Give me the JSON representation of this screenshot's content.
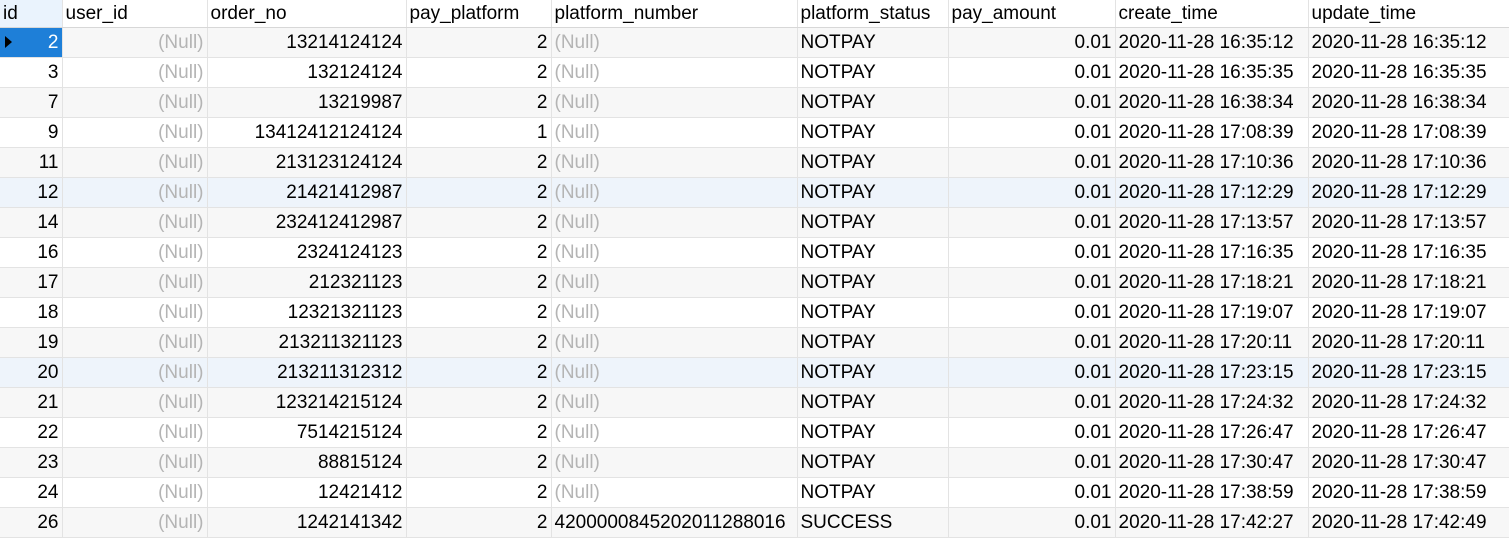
{
  "columns": [
    "id",
    "user_id",
    "order_no",
    "pay_platform",
    "platform_number",
    "platform_status",
    "pay_amount",
    "create_time",
    "update_time"
  ],
  "rows": [
    {
      "id": "2",
      "user_id": "(Null)",
      "order_no": "13214124124",
      "pay_platform": "2",
      "platform_number": "(Null)",
      "platform_status": "NOTPAY",
      "pay_amount": "0.01",
      "create_time": "2020-11-28 16:35:12",
      "update_time": "2020-11-28 16:35:12"
    },
    {
      "id": "3",
      "user_id": "(Null)",
      "order_no": "132124124",
      "pay_platform": "2",
      "platform_number": "(Null)",
      "platform_status": "NOTPAY",
      "pay_amount": "0.01",
      "create_time": "2020-11-28 16:35:35",
      "update_time": "2020-11-28 16:35:35"
    },
    {
      "id": "7",
      "user_id": "(Null)",
      "order_no": "13219987",
      "pay_platform": "2",
      "platform_number": "(Null)",
      "platform_status": "NOTPAY",
      "pay_amount": "0.01",
      "create_time": "2020-11-28 16:38:34",
      "update_time": "2020-11-28 16:38:34"
    },
    {
      "id": "9",
      "user_id": "(Null)",
      "order_no": "13412412124124",
      "pay_platform": "1",
      "platform_number": "(Null)",
      "platform_status": "NOTPAY",
      "pay_amount": "0.01",
      "create_time": "2020-11-28 17:08:39",
      "update_time": "2020-11-28 17:08:39"
    },
    {
      "id": "11",
      "user_id": "(Null)",
      "order_no": "213123124124",
      "pay_platform": "2",
      "platform_number": "(Null)",
      "platform_status": "NOTPAY",
      "pay_amount": "0.01",
      "create_time": "2020-11-28 17:10:36",
      "update_time": "2020-11-28 17:10:36"
    },
    {
      "id": "12",
      "user_id": "(Null)",
      "order_no": "21421412987",
      "pay_platform": "2",
      "platform_number": "(Null)",
      "platform_status": "NOTPAY",
      "pay_amount": "0.01",
      "create_time": "2020-11-28 17:12:29",
      "update_time": "2020-11-28 17:12:29"
    },
    {
      "id": "14",
      "user_id": "(Null)",
      "order_no": "232412412987",
      "pay_platform": "2",
      "platform_number": "(Null)",
      "platform_status": "NOTPAY",
      "pay_amount": "0.01",
      "create_time": "2020-11-28 17:13:57",
      "update_time": "2020-11-28 17:13:57"
    },
    {
      "id": "16",
      "user_id": "(Null)",
      "order_no": "2324124123",
      "pay_platform": "2",
      "platform_number": "(Null)",
      "platform_status": "NOTPAY",
      "pay_amount": "0.01",
      "create_time": "2020-11-28 17:16:35",
      "update_time": "2020-11-28 17:16:35"
    },
    {
      "id": "17",
      "user_id": "(Null)",
      "order_no": "212321123",
      "pay_platform": "2",
      "platform_number": "(Null)",
      "platform_status": "NOTPAY",
      "pay_amount": "0.01",
      "create_time": "2020-11-28 17:18:21",
      "update_time": "2020-11-28 17:18:21"
    },
    {
      "id": "18",
      "user_id": "(Null)",
      "order_no": "12321321123",
      "pay_platform": "2",
      "platform_number": "(Null)",
      "platform_status": "NOTPAY",
      "pay_amount": "0.01",
      "create_time": "2020-11-28 17:19:07",
      "update_time": "2020-11-28 17:19:07"
    },
    {
      "id": "19",
      "user_id": "(Null)",
      "order_no": "213211321123",
      "pay_platform": "2",
      "platform_number": "(Null)",
      "platform_status": "NOTPAY",
      "pay_amount": "0.01",
      "create_time": "2020-11-28 17:20:11",
      "update_time": "2020-11-28 17:20:11"
    },
    {
      "id": "20",
      "user_id": "(Null)",
      "order_no": "213211312312",
      "pay_platform": "2",
      "platform_number": "(Null)",
      "platform_status": "NOTPAY",
      "pay_amount": "0.01",
      "create_time": "2020-11-28 17:23:15",
      "update_time": "2020-11-28 17:23:15"
    },
    {
      "id": "21",
      "user_id": "(Null)",
      "order_no": "123214215124",
      "pay_platform": "2",
      "platform_number": "(Null)",
      "platform_status": "NOTPAY",
      "pay_amount": "0.01",
      "create_time": "2020-11-28 17:24:32",
      "update_time": "2020-11-28 17:24:32"
    },
    {
      "id": "22",
      "user_id": "(Null)",
      "order_no": "7514215124",
      "pay_platform": "2",
      "platform_number": "(Null)",
      "platform_status": "NOTPAY",
      "pay_amount": "0.01",
      "create_time": "2020-11-28 17:26:47",
      "update_time": "2020-11-28 17:26:47"
    },
    {
      "id": "23",
      "user_id": "(Null)",
      "order_no": "88815124",
      "pay_platform": "2",
      "platform_number": "(Null)",
      "platform_status": "NOTPAY",
      "pay_amount": "0.01",
      "create_time": "2020-11-28 17:30:47",
      "update_time": "2020-11-28 17:30:47"
    },
    {
      "id": "24",
      "user_id": "(Null)",
      "order_no": "12421412",
      "pay_platform": "2",
      "platform_number": "(Null)",
      "platform_status": "NOTPAY",
      "pay_amount": "0.01",
      "create_time": "2020-11-28 17:38:59",
      "update_time": "2020-11-28 17:38:59"
    },
    {
      "id": "26",
      "user_id": "(Null)",
      "order_no": "1242141342",
      "pay_platform": "2",
      "platform_number": "4200000845202011288016",
      "platform_status": "SUCCESS",
      "pay_amount": "0.01",
      "create_time": "2020-11-28 17:42:27",
      "update_time": "2020-11-28 17:42:49"
    }
  ],
  "selected_row_index": 0,
  "highlighted_row_indexes": [
    5,
    11
  ],
  "colors": {
    "selection": "#1e7fd8",
    "null_text": "#b4b4b4",
    "grid_line": "#e3e3e3",
    "row_highlight": "#eef4fb"
  }
}
